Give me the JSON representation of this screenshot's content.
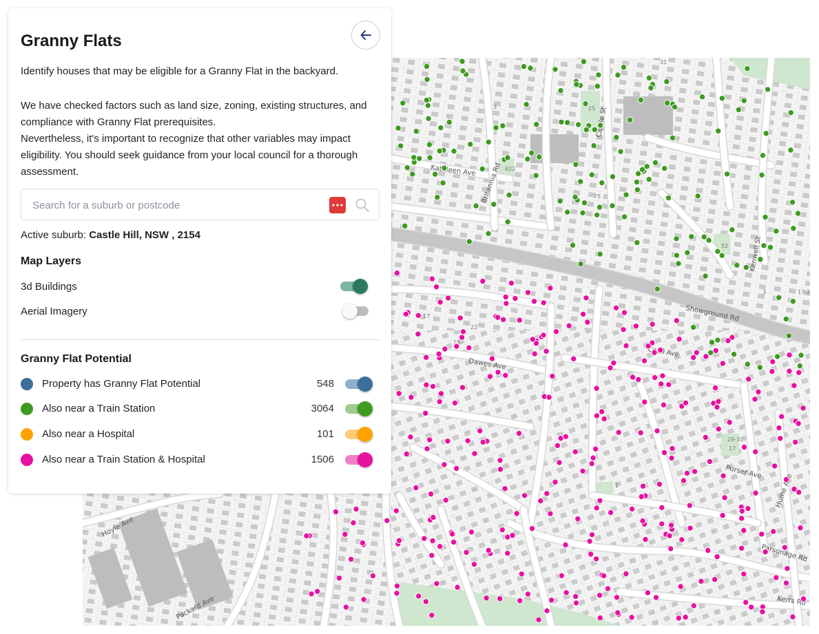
{
  "panel": {
    "title": "Granny Flats",
    "back_icon": "arrow-left-icon",
    "intro": "Identify houses that may be eligible for a Granny Flat in the backyard.",
    "body": "We have checked factors such as land size, zoning, existing structures, and compliance with Granny Flat prerequisites.\nNevertheless, it's important to recognize that other variables may impact eligibility. You should seek guidance from your local council for a thorough assessment.",
    "search": {
      "placeholder": "Search for a suburb or postcode",
      "value": "",
      "more_icon": "more-dots-icon",
      "search_icon": "search-icon"
    },
    "active_suburb": {
      "label": "Active suburb:",
      "value": "Castle Hill, NSW , 2154"
    }
  },
  "map_layers": {
    "title": "Map Layers",
    "items": [
      {
        "label": "3d Buildings",
        "enabled": true,
        "color": "#2b7a5f"
      },
      {
        "label": "Aerial Imagery",
        "enabled": false,
        "color": "#bdbdbd"
      }
    ]
  },
  "potential": {
    "title": "Granny Flat Potential",
    "items": [
      {
        "label": "Property has Granny Flat Potential",
        "count": "548",
        "color": "#3b6e9a",
        "enabled": true
      },
      {
        "label": "Also near a Train Station",
        "count": "3064",
        "color": "#3f9a22",
        "enabled": true
      },
      {
        "label": "Also near a Hospital",
        "count": "101",
        "color": "#ffa200",
        "enabled": true
      },
      {
        "label": "Also near a Train Station & Hospital",
        "count": "1506",
        "color": "#e612a0",
        "enabled": true
      }
    ]
  },
  "map": {
    "street_labels": [
      "Kathleen Ave",
      "Britannia Rd",
      "Castle St",
      "Showground Rd",
      "Cecil Ave",
      "Dawes Ave",
      "Purser Ave",
      "Hume Ave",
      "Parsonage Rd",
      "Kerrs Rd",
      "Hoyle Ave",
      "Packard Ave",
      "Kenwell St"
    ],
    "lot_numbers": [
      "31",
      "3",
      "25",
      "75",
      "622",
      "15",
      "17",
      "22",
      "28",
      "52",
      "17-25",
      "29-33",
      "3",
      "17",
      "1"
    ],
    "colors": {
      "road": "#c9c9c9",
      "road_edge": "#dedede",
      "building": "#c2c2c2",
      "park": "#cfe6cf",
      "land": "#f5f5f5",
      "parcel": "#e4e4e4"
    }
  }
}
